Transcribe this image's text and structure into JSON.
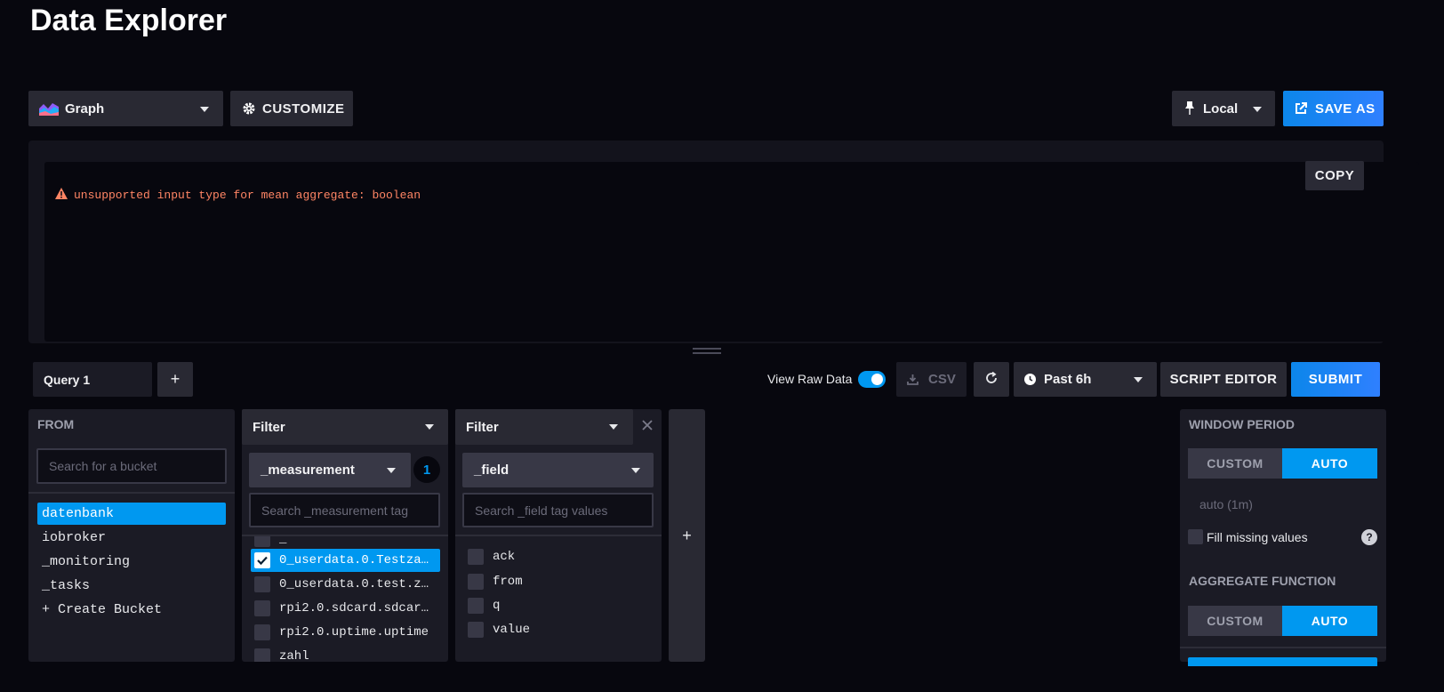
{
  "page": {
    "title": "Data Explorer"
  },
  "toolbar": {
    "view_type": "Graph",
    "customize_label": "CUSTOMIZE",
    "timezone": "Local",
    "save_as_label": "SAVE AS"
  },
  "results": {
    "copy_label": "COPY",
    "error_message": "unsupported input type for mean aggregate: boolean"
  },
  "query_bar": {
    "tab_label": "Query 1",
    "add_label": "+",
    "view_raw_label": "View Raw Data",
    "csv_label": "CSV",
    "time_range": "Past 6h",
    "script_editor_label": "SCRIPT EDITOR",
    "submit_label": "SUBMIT"
  },
  "from": {
    "header": "FROM",
    "search_placeholder": "Search for a bucket",
    "buckets": [
      "datenbank",
      "iobroker",
      "_monitoring",
      "_tasks"
    ],
    "create_label": "+ Create Bucket"
  },
  "filter1": {
    "header": "Filter",
    "key": "_measurement",
    "selected_count": "1",
    "search_placeholder": "Search _measurement tag",
    "partial_top": "_",
    "items": [
      {
        "label": "0_userdata.0.Testza…",
        "checked": true
      },
      {
        "label": "0_userdata.0.test.z…",
        "checked": false
      },
      {
        "label": "rpi2.0.sdcard.sdcar…",
        "checked": false
      },
      {
        "label": "rpi2.0.uptime.uptime",
        "checked": false
      },
      {
        "label": "zahl",
        "checked": false
      }
    ]
  },
  "filter2": {
    "header": "Filter",
    "key": "_field",
    "search_placeholder": "Search _field tag values",
    "items": [
      "ack",
      "from",
      "q",
      "value"
    ]
  },
  "add_filter_label": "+",
  "window_panel": {
    "window_header": "WINDOW PERIOD",
    "custom_label": "CUSTOM",
    "auto_label": "AUTO",
    "auto_value": "auto (1m)",
    "fill_missing_label": "Fill missing values",
    "help_label": "?",
    "aggregate_header": "AGGREGATE FUNCTION",
    "agg_custom_label": "CUSTOM",
    "agg_auto_label": "AUTO"
  },
  "colors": {
    "accent": "#0098f0",
    "error": "#ff8564",
    "background": "#07070e"
  }
}
